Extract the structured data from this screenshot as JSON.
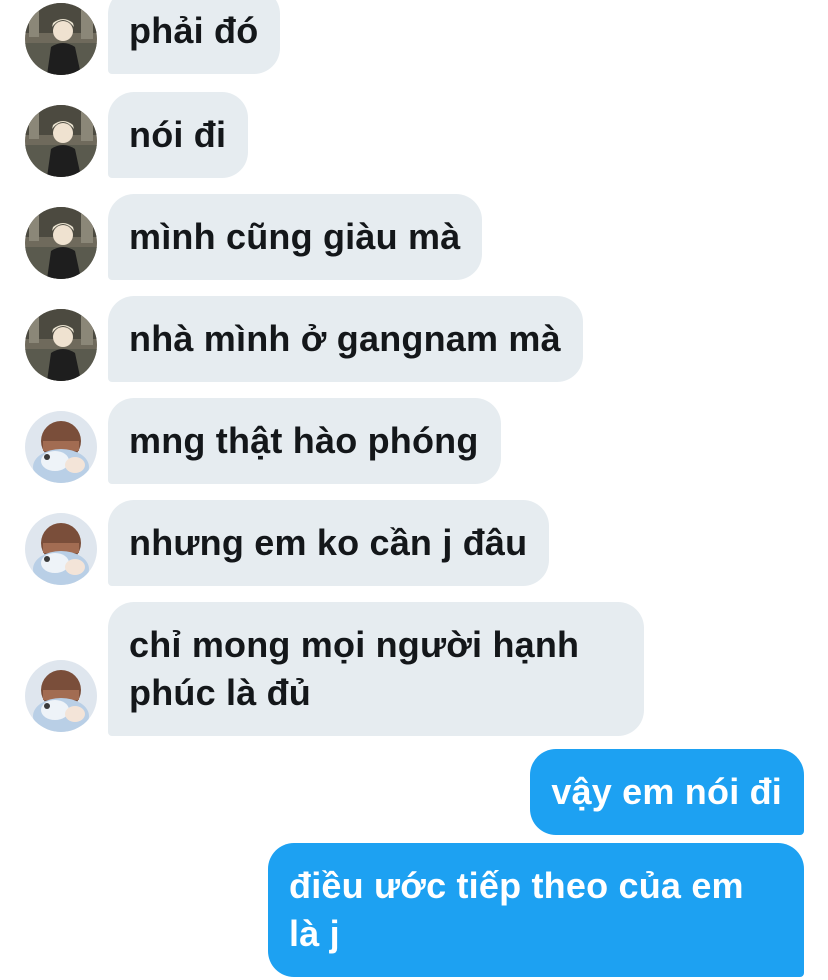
{
  "conversation": {
    "messages": [
      {
        "sender": "them",
        "avatar": "user-a-avatar",
        "text": "phải đó"
      },
      {
        "sender": "them",
        "avatar": "user-a-avatar",
        "text": "nói đi"
      },
      {
        "sender": "them",
        "avatar": "user-a-avatar",
        "text": "mình cũng giàu mà"
      },
      {
        "sender": "them",
        "avatar": "user-a-avatar",
        "text": "nhà mình ở gangnam mà"
      },
      {
        "sender": "them",
        "avatar": "user-b-avatar",
        "text": "mng thật hào phóng"
      },
      {
        "sender": "them",
        "avatar": "user-b-avatar",
        "text": "nhưng em ko cần j đâu"
      },
      {
        "sender": "them",
        "avatar": "user-b-avatar",
        "text": "chỉ mong mọi người hạnh phúc là đủ"
      },
      {
        "sender": "me",
        "text": "vậy em nói đi"
      },
      {
        "sender": "me",
        "text": "điều ước tiếp theo của em là j"
      }
    ]
  },
  "colors": {
    "incoming_bubble": "#e6ecf0",
    "incoming_text": "#14171a",
    "outgoing_bubble": "#1da1f2",
    "outgoing_text": "#ffffff"
  }
}
